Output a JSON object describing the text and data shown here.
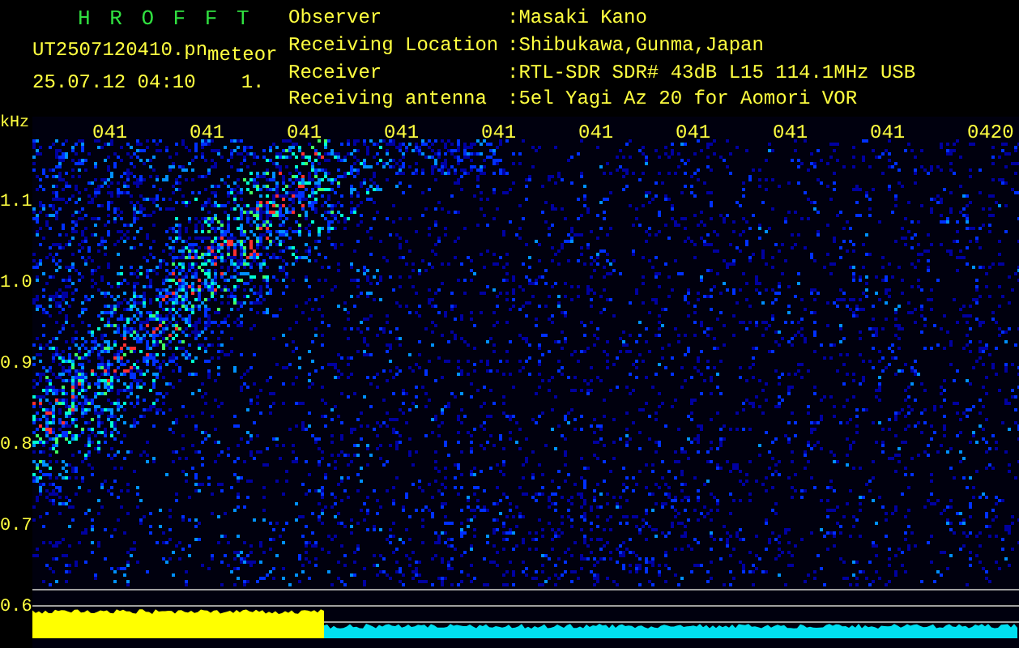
{
  "title": "H R O F F T",
  "file_name": "UT2507120410.pn",
  "file_tag": "meteor",
  "timestamp": "25.07.12 04:10",
  "counter": "1.",
  "info": [
    {
      "label": "Observer",
      "value": ":Masaki Kano"
    },
    {
      "label": "Receiving Location",
      "value": ":Shibukawa,Gunma,Japan"
    },
    {
      "label": "Receiver",
      "value": ":RTL-SDR SDR# 43dB L15 114.1MHz USB"
    },
    {
      "label": "Receiving antenna",
      "value": ":5el Yagi Az 20 for Aomori VOR"
    }
  ],
  "frequency_unit": "kHz",
  "frequency_ticks": [
    "1.1",
    "1.0",
    "0.9",
    "0.8",
    "0.7",
    "0.6"
  ],
  "time_ticks": [
    "041",
    "041",
    "041",
    "041",
    "041",
    "041",
    "041",
    "041",
    "041",
    "0420"
  ]
}
